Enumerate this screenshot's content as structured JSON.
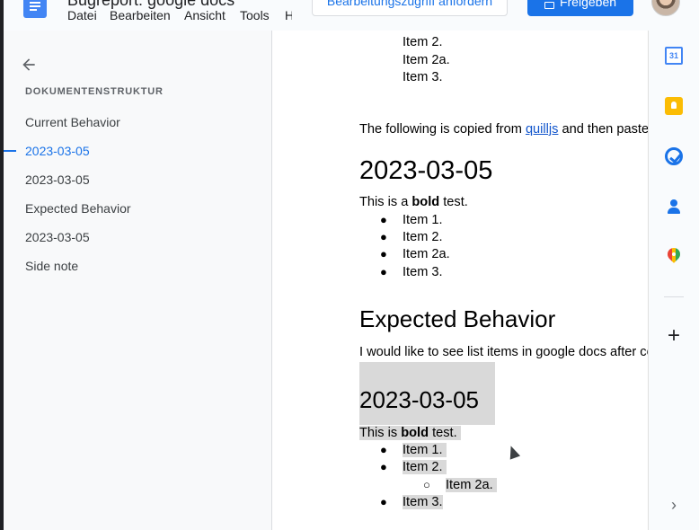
{
  "topbar": {
    "doc_title": "Bugreport: google docs",
    "menu": [
      "Datei",
      "Bearbeiten",
      "Ansicht",
      "Tools",
      "Hilfe"
    ],
    "request_access_label": "Bearbeitungszugriff anfordern",
    "share_label": "Freigeben"
  },
  "outline": {
    "heading": "DOKUMENTENSTRUKTUR",
    "items": [
      {
        "label": "Current Behavior",
        "active": false
      },
      {
        "label": "2023-03-05",
        "active": true
      },
      {
        "label": "2023-03-05",
        "active": false
      },
      {
        "label": "Expected Behavior",
        "active": false
      },
      {
        "label": "2023-03-05",
        "active": false
      },
      {
        "label": "Side note",
        "active": false
      }
    ]
  },
  "document": {
    "top_items": [
      "Item 2.",
      "Item 2a.",
      "Item 3."
    ],
    "copied_prefix": "The following is copied from ",
    "copied_link": "quilljs",
    "copied_suffix": " and then pasted",
    "heading_1": "2023-03-05",
    "bold_prefix_1": "This is a ",
    "bold_word": "bold",
    "bold_suffix": " test.",
    "list_1": [
      "Item 1.",
      "Item 2.",
      "Item 2a.",
      "Item 3."
    ],
    "bullet": "●",
    "sub_bullet": "○",
    "heading_expected": "Expected Behavior",
    "expected_text": "I would like to see list items in google docs after copying",
    "heading_2": "2023-03-05",
    "bold_prefix_2": "This is ",
    "list_2": [
      "Item 1.",
      "Item 2.",
      "Item 2a.",
      "Item 3."
    ]
  },
  "sidepanel": {
    "calendar_day": "31",
    "icons": [
      "calendar-icon",
      "keep-icon",
      "tasks-icon",
      "contacts-icon",
      "maps-icon",
      "plus-icon",
      "chevron-right-icon"
    ],
    "plus": "+",
    "chevron": "›"
  },
  "colors": {
    "accent": "#1a73e8",
    "link": "#1155cc",
    "highlight": "#d9d9d9"
  }
}
